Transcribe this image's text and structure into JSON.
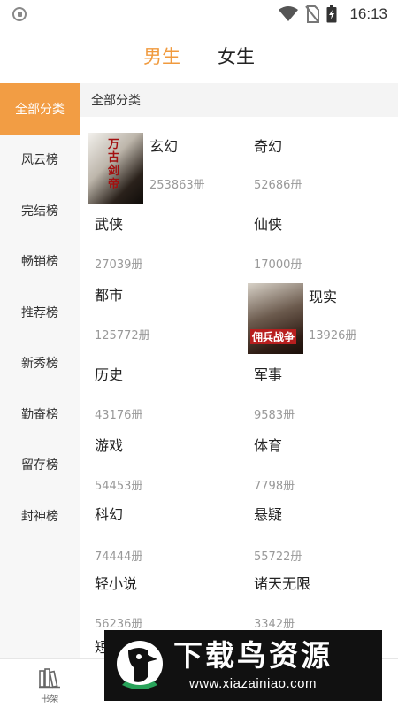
{
  "status_bar": {
    "time": "16:13"
  },
  "header": {
    "tabs": [
      {
        "label": "男生",
        "active": true
      },
      {
        "label": "女生",
        "active": false
      }
    ]
  },
  "left_nav": {
    "items": [
      {
        "label": "全部分类",
        "active": true
      },
      {
        "label": "风云榜"
      },
      {
        "label": "完结榜"
      },
      {
        "label": "畅销榜"
      },
      {
        "label": "推荐榜"
      },
      {
        "label": "新秀榜"
      },
      {
        "label": "勤奋榜"
      },
      {
        "label": "留存榜"
      },
      {
        "label": "封神榜"
      }
    ]
  },
  "main": {
    "section_title": "全部分类",
    "categories": [
      {
        "name": "玄幻",
        "count": "253863册",
        "cover_title": "万古剑帝"
      },
      {
        "name": "奇幻",
        "count": "52686册"
      },
      {
        "name": "武侠",
        "count": "27039册"
      },
      {
        "name": "仙侠",
        "count": "17000册"
      },
      {
        "name": "都市",
        "count": "125772册"
      },
      {
        "name": "现实",
        "count": "13926册",
        "cover_title": "佣兵战争"
      },
      {
        "name": "历史",
        "count": "43176册"
      },
      {
        "name": "军事",
        "count": "9583册"
      },
      {
        "name": "游戏",
        "count": "54453册"
      },
      {
        "name": "体育",
        "count": "7798册"
      },
      {
        "name": "科幻",
        "count": "74444册"
      },
      {
        "name": "悬疑",
        "count": "55722册"
      },
      {
        "name": "轻小说",
        "count": "56236册"
      },
      {
        "name": "诸天无限",
        "count": "3342册"
      },
      {
        "name": "短"
      }
    ]
  },
  "bottom_nav": {
    "items": [
      {
        "label": "书架"
      }
    ]
  },
  "watermark": {
    "title": "下载鸟资源",
    "url": "www.xiazainiao.com"
  },
  "colors": {
    "accent": "#f09a3e",
    "active_nav": "#f29d44"
  }
}
